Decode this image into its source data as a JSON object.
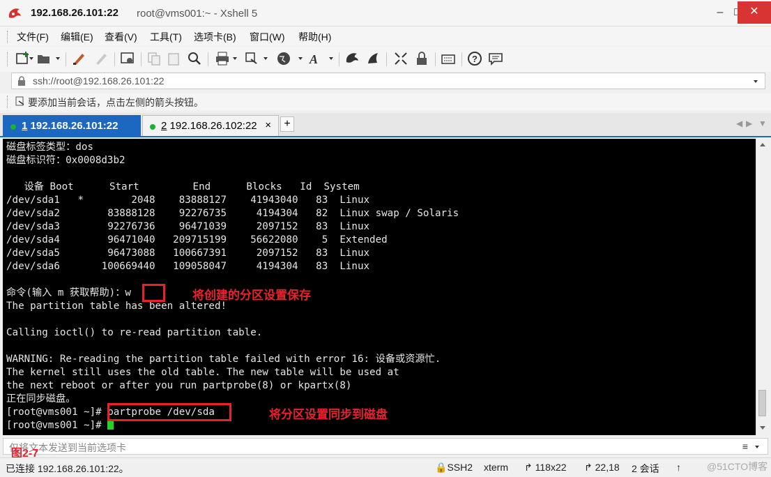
{
  "window": {
    "title_host": "192.168.26.101:22",
    "title_rest": "root@vms001:~ - Xshell 5",
    "minimize_icon": "minimize-icon",
    "maximize_icon": "maximize-icon",
    "close_icon": "close-icon"
  },
  "menu": {
    "items": [
      "文件(F)",
      "编辑(E)",
      "查看(V)",
      "工具(T)",
      "选项卡(B)",
      "窗口(W)",
      "帮助(H)"
    ]
  },
  "toolbar": {
    "icons": [
      "new-session-icon",
      "open-folder-icon",
      "properties-icon",
      "disconnect-icon",
      "settings-icon",
      "copy-icon",
      "paste-icon",
      "find-icon",
      "print-icon",
      "transfer-icon",
      "globe-icon",
      "font-icon",
      "xftp-icon",
      "xmanager-icon",
      "fullscreen-icon",
      "lock-icon",
      "keyboard-icon",
      "help-icon",
      "chat-icon"
    ]
  },
  "address": {
    "value": "ssh://root@192.168.26.101:22"
  },
  "hint": {
    "text": "要添加当前会话，点击左侧的箭头按钮。"
  },
  "tabs": [
    {
      "number": "1",
      "host": "192.168.26.101:22",
      "active": true
    },
    {
      "number": "2",
      "host": "192.168.26.102:22",
      "active": false,
      "close": "×"
    }
  ],
  "tab_add": "+",
  "terminal": {
    "lines": [
      "磁盘标签类型：dos",
      "磁盘标识符：0x0008d3b2",
      "",
      "   设备 Boot      Start         End      Blocks   Id  System",
      "/dev/sda1   *        2048    83888127    41943040   83  Linux",
      "/dev/sda2        83888128    92276735     4194304   82  Linux swap / Solaris",
      "/dev/sda3        92276736    96471039     2097152   83  Linux",
      "/dev/sda4        96471040   209715199    56622080    5  Extended",
      "/dev/sda5        96473088   100667391     2097152   83  Linux",
      "/dev/sda6       100669440   109058047     4194304   83  Linux",
      "",
      "命令(输入 m 获取帮助)：w",
      "The partition table has been altered!",
      "",
      "Calling ioctl() to re-read partition table.",
      "",
      "WARNING: Re-reading the partition table failed with error 16: 设备或资源忙.",
      "The kernel still uses the old table. The new table will be used at",
      "the next reboot or after you run partprobe(8) or kpartx(8)",
      "正在同步磁盘。",
      "[root@vms001 ~]# partprobe /dev/sda",
      "[root@vms001 ~]# "
    ],
    "annotation_save": "将创建的分区设置保存",
    "annotation_sync": "将分区设置同步到磁盘"
  },
  "compose": {
    "placeholder": "仅将文本发送到当前选项卡",
    "figure_label": "图2-7"
  },
  "status": {
    "connected": "已连接 192.168.26.101:22。",
    "protocol": "SSH2",
    "term": "xterm",
    "size": "118x22",
    "cursor_pos": "22,18",
    "sessions": "2 会话",
    "watermark": "@51CTO博客"
  },
  "colors": {
    "tab_active": "#1c67bf",
    "annotation": "#e8222d",
    "cursor": "#20d620",
    "status_dot": "#1ab233"
  }
}
